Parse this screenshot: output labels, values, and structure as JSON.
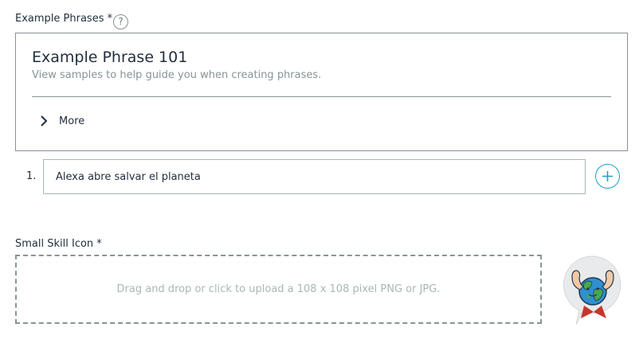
{
  "example_phrases": {
    "label": "Example Phrases *",
    "help_symbol": "?",
    "panel": {
      "title": "Example Phrase 101",
      "subtitle": "View samples to help guide you when creating phrases.",
      "more_label": "More"
    },
    "rows": [
      {
        "number": "1.",
        "value": "Alexa abre salvar el planeta"
      }
    ]
  },
  "small_skill_icon": {
    "label": "Small Skill Icon *",
    "upload_hint": "Drag and drop or click to upload a 108 x 108 pixel PNG or JPG."
  },
  "icons": {
    "help": "question-mark-circle-icon",
    "more": "chevron-right-icon",
    "add": "plus-circle-icon",
    "skill": "earth-strongman-speech-bubble-icon"
  },
  "colors": {
    "text": "#232f3e",
    "muted_text": "#879596",
    "border": "#8a8f94",
    "accent": "#1ba1c4",
    "placeholder": "#aab7b8"
  }
}
